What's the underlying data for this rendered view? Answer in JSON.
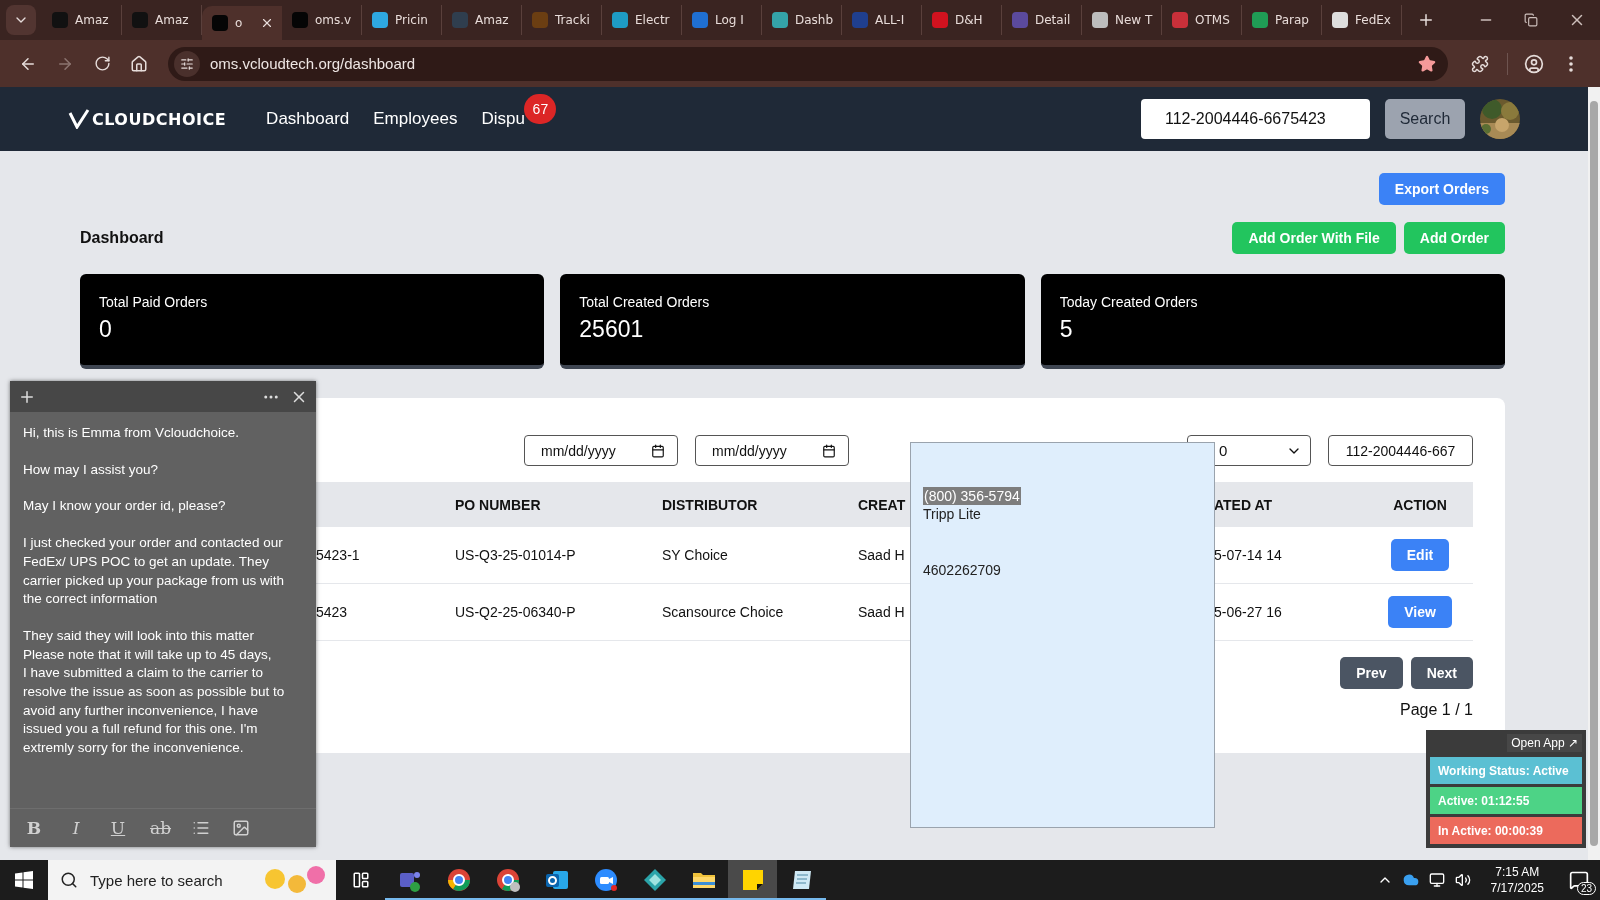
{
  "browser": {
    "tabs": [
      {
        "title": "Amaz",
        "selected": false,
        "color": "#111111"
      },
      {
        "title": "Amaz",
        "selected": false,
        "color": "#111111"
      },
      {
        "title": "o",
        "selected": true,
        "color": "#050505"
      },
      {
        "title": "oms.v",
        "selected": false,
        "color": "#050505"
      },
      {
        "title": "Pricin",
        "selected": false,
        "color": "#2ea8e0"
      },
      {
        "title": "Amaz",
        "selected": false,
        "color": "#2f3e4e"
      },
      {
        "title": "Tracki",
        "selected": false,
        "color": "#6b3e12"
      },
      {
        "title": "Electr",
        "selected": false,
        "color": "#1e9bc4"
      },
      {
        "title": "Log I",
        "selected": false,
        "color": "#1f6fd1"
      },
      {
        "title": "Dashb",
        "selected": false,
        "color": "#34a3a8"
      },
      {
        "title": "ALL-I",
        "selected": false,
        "color": "#1f3f8f"
      },
      {
        "title": "D&H",
        "selected": false,
        "color": "#d1121f"
      },
      {
        "title": "Detail",
        "selected": false,
        "color": "#5b4a9e"
      },
      {
        "title": "New T",
        "selected": false,
        "color": "#bdbdbd"
      },
      {
        "title": "OTMS",
        "selected": false,
        "color": "#c9303a"
      },
      {
        "title": "Parap",
        "selected": false,
        "color": "#1f9d55"
      },
      {
        "title": "FedEx",
        "selected": false,
        "color": "#dddddd"
      }
    ],
    "url": "oms.vcloudtech.org/dashboard"
  },
  "app": {
    "logo": "CLOUDCHOICE",
    "nav": [
      {
        "label": "Dashboard"
      },
      {
        "label": "Employees"
      },
      {
        "label": "Dispu",
        "badge": "67"
      }
    ],
    "search": {
      "value": "112-2004446-6675423",
      "button": "Search"
    }
  },
  "actions": {
    "export": "Export Orders",
    "add_with_file": "Add Order With File",
    "add": "Add Order"
  },
  "title": "Dashboard",
  "stats": [
    {
      "label": "Total Paid Orders",
      "value": "0"
    },
    {
      "label": "Total Created Orders",
      "value": "25601"
    },
    {
      "label": "Today Created Orders",
      "value": "5"
    }
  ],
  "filters": {
    "date_from": {
      "placeholder": "mm/dd/yyyy"
    },
    "date_to": {
      "placeholder": "mm/dd/yyyy"
    },
    "page_size": "0",
    "search": "112-2004446-667"
  },
  "table": {
    "columns": [
      "PO NUMBER",
      "DISTRIBUTOR",
      "CREAT",
      "ATED AT",
      "ACTION"
    ],
    "rows": [
      {
        "column_1": "5423-1",
        "cells": [
          "US-Q3-25-01014-P",
          "SY Choice",
          "Saad H",
          "5-07-14 14"
        ],
        "action": "Edit"
      },
      {
        "column_1": "5423",
        "cells": [
          "US-Q2-25-06340-P",
          "Scansource Choice",
          "Saad H",
          "5-06-27 16"
        ],
        "action": "View"
      }
    ]
  },
  "pagination": {
    "prev": "Prev",
    "next": "Next",
    "page": "Page 1 / 1"
  },
  "popup": {
    "phone": {
      "text": "(800) 356-5794",
      "selected": true
    },
    "company": "Tripp Lite",
    "number": "4602262709"
  },
  "sticky_note": {
    "paragraphs": [
      "Hi, this is Emma from Vcloudchoice.",
      "How may I assist you?",
      "May I know your order id, please?",
      "I just checked your order and contacted our\nFedEx/ UPS POC to get an update. They\ncarrier picked up your package from us with\nthe correct information",
      "They said they will look into this matter\nPlease note that it will take up to 45 days,\nI have submitted a claim to the carrier to\nresolve the issue as soon as possible but to\navoid any further inconvenience, I have\nissued you a full refund for this one. I'm\nextremly sorry for the inconvenience."
    ],
    "toolbar": [
      "B",
      "I",
      "U",
      "ab"
    ]
  },
  "tracker": {
    "open_app": "Open App ↗",
    "statuses": [
      {
        "text": "Working Status: Active",
        "color": "#5bc0d3"
      },
      {
        "text": "Active: 01:12:55",
        "color": "#4dd386"
      },
      {
        "text": "In Active: 00:00:39",
        "color": "#ec6a5c"
      }
    ]
  },
  "taskbar": {
    "search_placeholder": "Type here to search",
    "apps": [
      {
        "selected": false
      },
      {
        "selected": false
      },
      {
        "selected": false
      },
      {
        "selected": false
      },
      {
        "selected": false
      },
      {
        "selected": false
      },
      {
        "selected": false
      },
      {
        "selected": true
      },
      {
        "selected": false
      }
    ],
    "time": "7:15 AM",
    "date": "7/17/2025",
    "notifications": "23"
  }
}
